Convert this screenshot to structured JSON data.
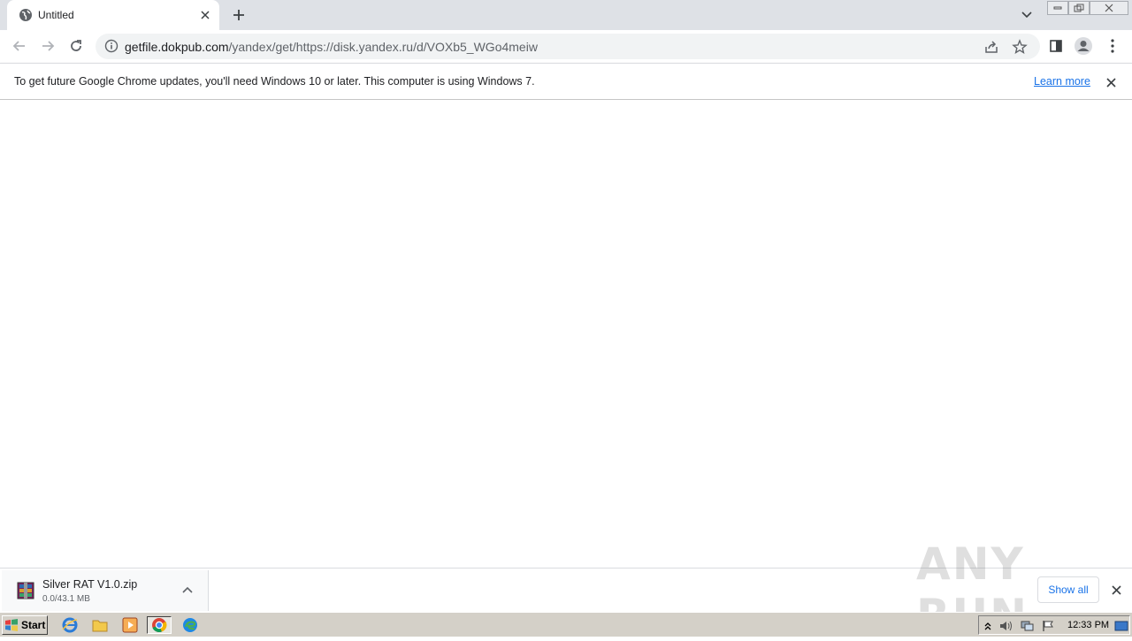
{
  "browser": {
    "tab_title": "Untitled",
    "url_host": "getfile.dokpub.com",
    "url_path": "/yandex/get/https://disk.yandex.ru/d/VOXb5_WGo4meiw"
  },
  "infobar": {
    "message": "To get future Google Chrome updates, you'll need Windows 10 or later. This computer is using Windows 7.",
    "link": "Learn more"
  },
  "download": {
    "filename": "Silver RAT V1.0.zip",
    "status": "0.0/43.1 MB",
    "show_all": "Show all"
  },
  "watermark": "ANY RUN",
  "taskbar": {
    "start_label": "Start",
    "time": "12:33 PM"
  },
  "colors": {
    "tabstrip": "#dee1e6",
    "link": "#1a73e8",
    "taskbar": "#d4d0c8"
  }
}
